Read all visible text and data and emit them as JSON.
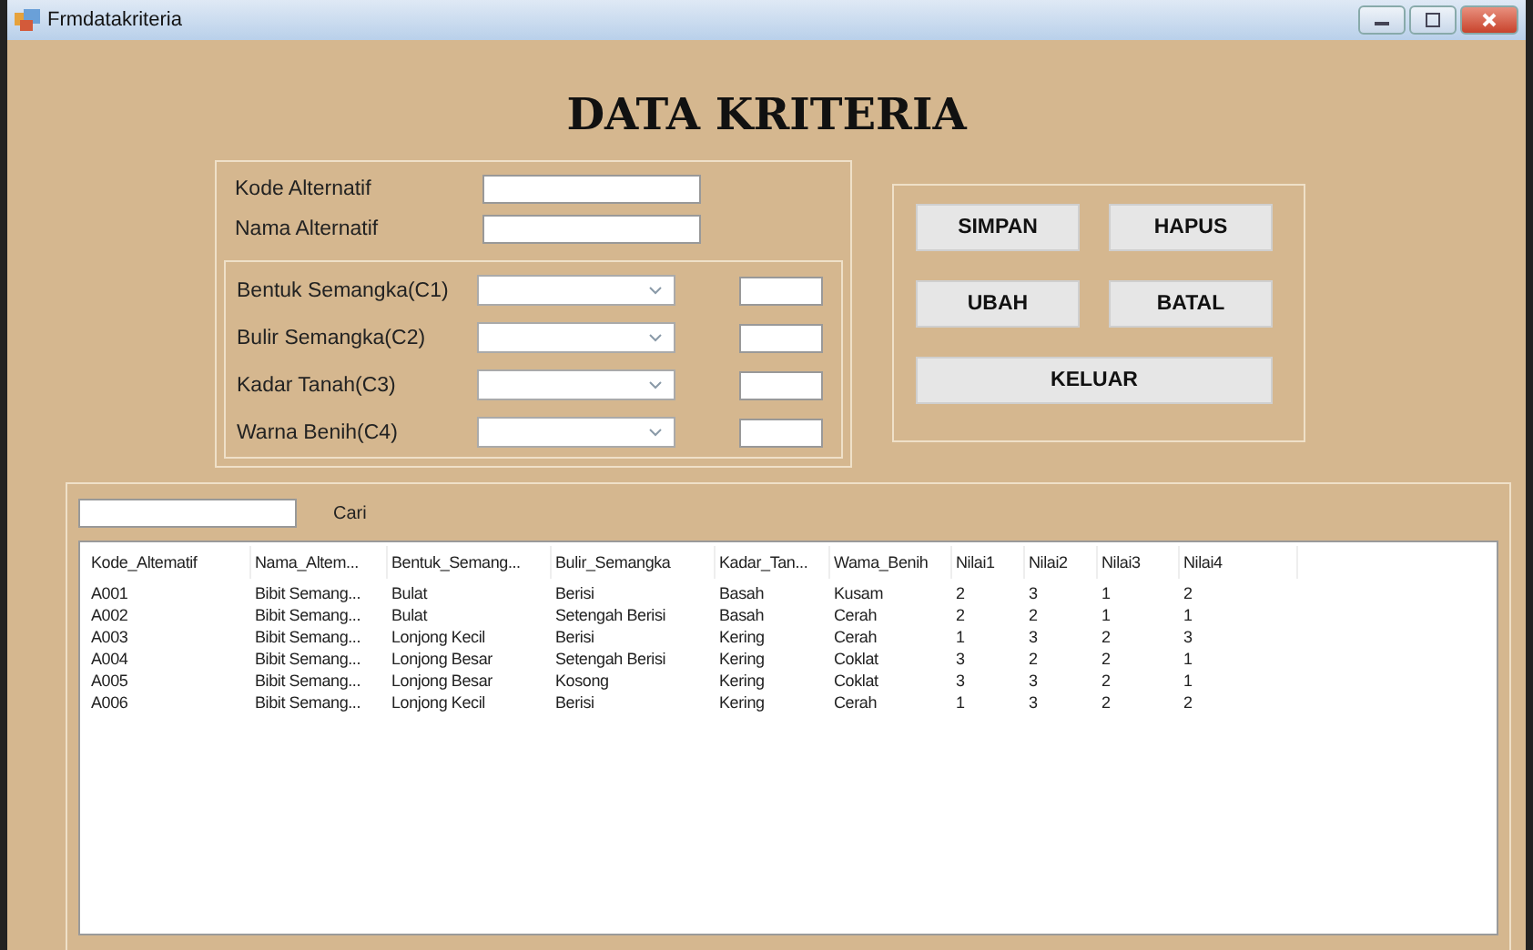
{
  "window": {
    "title": "Frmdatakriteria"
  },
  "heading": "DATA KRITERIA",
  "identity_fields": [
    {
      "label": "Kode Alternatif"
    },
    {
      "label": "Nama Alternatif"
    }
  ],
  "criteria": [
    {
      "label": "Bentuk Semangka(C1)"
    },
    {
      "label": "Bulir Semangka(C2)"
    },
    {
      "label": "Kadar Tanah(C3)"
    },
    {
      "label": "Warna Benih(C4)"
    }
  ],
  "buttons": [
    {
      "label": "SIMPAN",
      "wide": false
    },
    {
      "label": "HAPUS",
      "wide": false
    },
    {
      "label": "UBAH",
      "wide": false
    },
    {
      "label": "BATAL",
      "wide": false
    },
    {
      "label": "KELUAR",
      "wide": true
    }
  ],
  "search": {
    "button": "Cari"
  },
  "table": {
    "columns": [
      "Kode_Altematif",
      "Nama_Altem...",
      "Bentuk_Semang...",
      "Bulir_Semangka",
      "Kadar_Tan...",
      "Wama_Benih",
      "Nilai1",
      "Nilai2",
      "Nilai3",
      "Nilai4"
    ],
    "rows": [
      [
        "A001",
        "Bibit Semang...",
        "Bulat",
        "Berisi",
        "Basah",
        "Kusam",
        "2",
        "3",
        "1",
        "2"
      ],
      [
        "A002",
        "Bibit Semang...",
        "Bulat",
        "Setengah Berisi",
        "Basah",
        "Cerah",
        "2",
        "2",
        "1",
        "1"
      ],
      [
        "A003",
        "Bibit Semang...",
        "Lonjong Kecil",
        "Berisi",
        "Kering",
        "Cerah",
        "1",
        "3",
        "2",
        "3"
      ],
      [
        "A004",
        "Bibit Semang...",
        "Lonjong Besar",
        "Setengah Berisi",
        "Kering",
        "Coklat",
        "3",
        "2",
        "2",
        "1"
      ],
      [
        "A005",
        "Bibit Semang...",
        "Lonjong Besar",
        "Kosong",
        "Kering",
        "Coklat",
        "3",
        "3",
        "2",
        "1"
      ],
      [
        "A006",
        "Bibit Semang...",
        "Lonjong Kecil",
        "Berisi",
        "Kering",
        "Cerah",
        "1",
        "3",
        "2",
        "2"
      ]
    ]
  }
}
